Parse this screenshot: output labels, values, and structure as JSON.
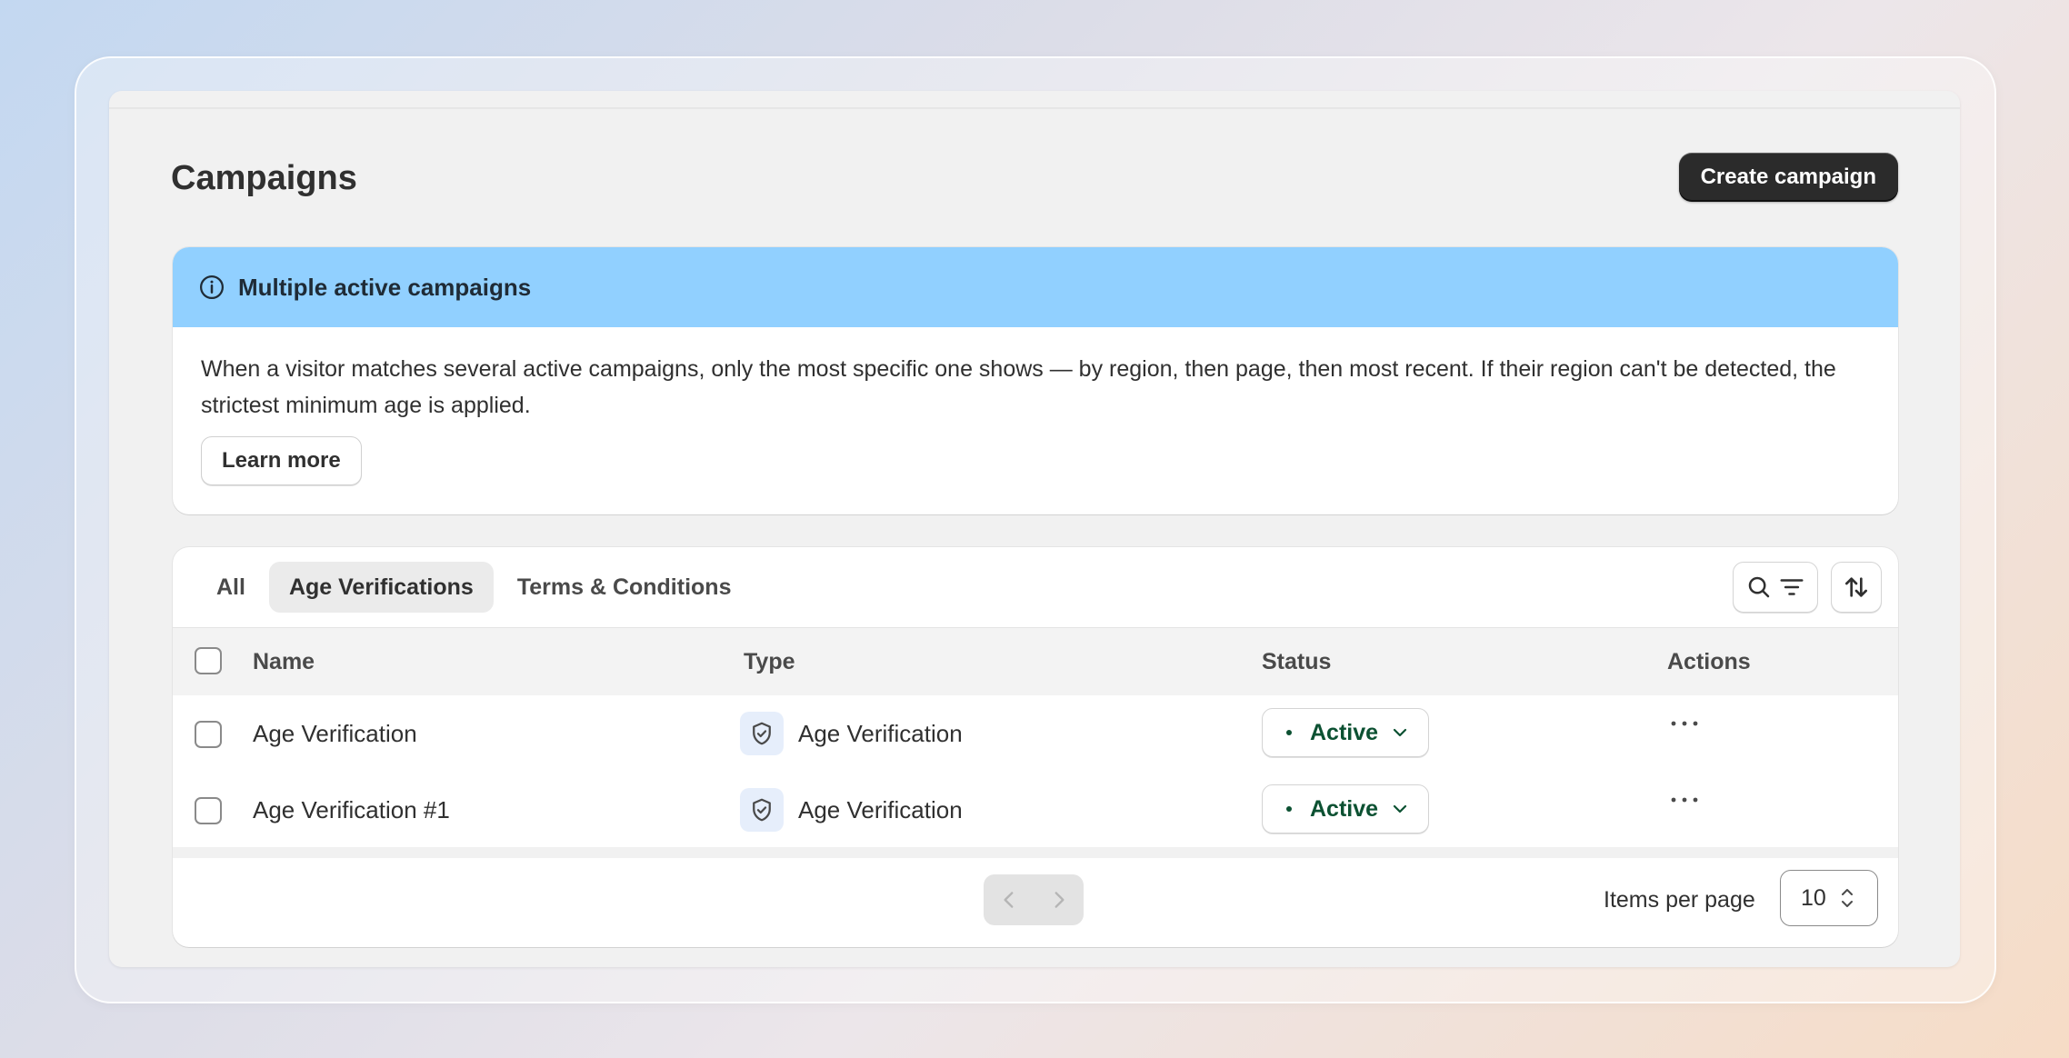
{
  "page": {
    "title": "Campaigns",
    "create_button": "Create campaign"
  },
  "banner": {
    "title": "Multiple active campaigns",
    "body": "When a visitor matches several active campaigns, only the most specific one shows — by region, then page, then most recent. If their region can't be detected, the strictest minimum age is applied.",
    "learn_more": "Learn more",
    "color": "#91d0ff"
  },
  "tabs": [
    {
      "label": "All",
      "active": false
    },
    {
      "label": "Age Verifications",
      "active": true
    },
    {
      "label": "Terms & Conditions",
      "active": false
    }
  ],
  "table": {
    "headers": {
      "name": "Name",
      "type": "Type",
      "status": "Status",
      "actions": "Actions"
    },
    "rows": [
      {
        "name": "Age Verification",
        "type": "Age Verification",
        "status": "Active",
        "actions": "···"
      },
      {
        "name": "Age Verification #1",
        "type": "Age Verification",
        "status": "Active",
        "actions": "···"
      }
    ]
  },
  "pagination": {
    "items_per_page_label": "Items per page",
    "items_per_page_value": "10"
  },
  "icons": {
    "info": "info-circle-icon",
    "search": "search-icon",
    "filter": "filter-icon",
    "sort": "sort-arrows-icon",
    "type": "shield-check-icon",
    "status_caret": "chevron-down-icon",
    "actions": "more-horizontal-icon",
    "prev": "chevron-left-icon",
    "next": "chevron-right-icon",
    "select_caret": "chevron-up-down-icon"
  },
  "colors": {
    "status_active": "#0c5132",
    "primary_button": "#2b2b2b"
  }
}
